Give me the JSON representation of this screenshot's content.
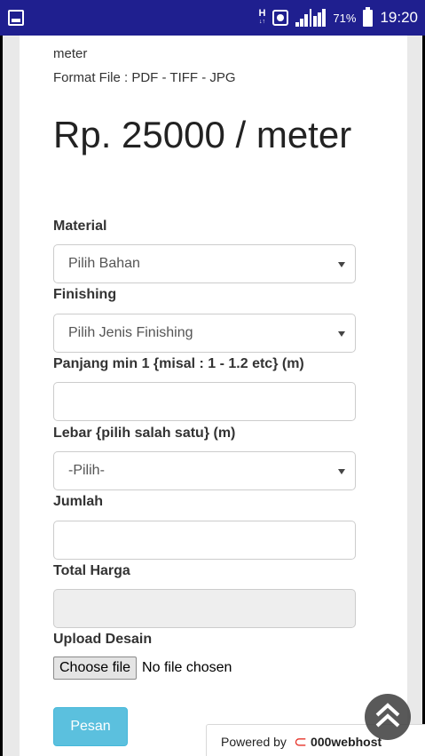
{
  "status_bar": {
    "network_label": "H",
    "battery_percent": "71%",
    "time": "19:20"
  },
  "info": {
    "line1": "meter",
    "line2": "Format File : PDF - TIFF - JPG"
  },
  "price_text": "Rp. 25000 / meter",
  "form": {
    "material_label": "Material",
    "material_value": "Pilih Bahan",
    "finishing_label": "Finishing",
    "finishing_value": "Pilih Jenis Finishing",
    "panjang_label": "Panjang min 1 {misal : 1 - 1.2 etc} (m)",
    "panjang_value": "",
    "lebar_label": "Lebar {pilih salah satu} (m)",
    "lebar_value": "-Pilih-",
    "jumlah_label": "Jumlah",
    "jumlah_value": "",
    "total_label": "Total Harga",
    "total_value": "",
    "upload_label": "Upload Desain",
    "choose_file_label": "Choose file",
    "no_file_text": "No file chosen",
    "submit_label": "Pesan"
  },
  "powered": {
    "prefix": "Powered by",
    "brand": "000webhost"
  }
}
